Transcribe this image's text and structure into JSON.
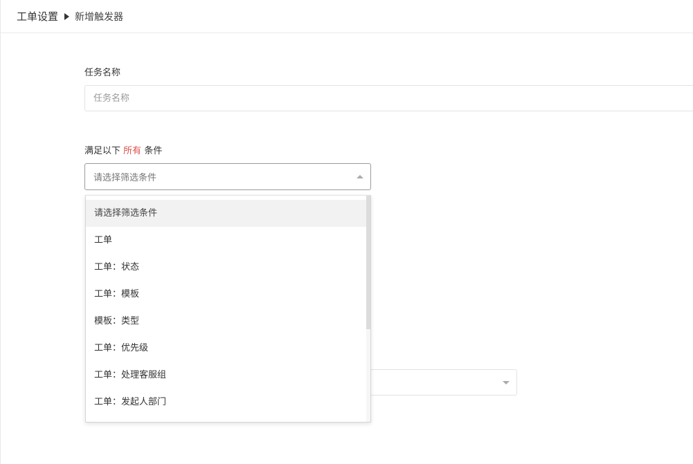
{
  "breadcrumb": {
    "root": "工单设置",
    "current": "新增触发器"
  },
  "task_name": {
    "label": "任务名称",
    "placeholder": "任务名称",
    "value": ""
  },
  "condition": {
    "label_prefix": "满足以下",
    "label_highlight": "所有",
    "label_suffix": "条件",
    "highlight_color": "#d9534f",
    "select_placeholder": "请选择筛选条件",
    "expanded": true
  },
  "dropdown": {
    "options": [
      "请选择筛选条件",
      "工单",
      "工单：状态",
      "工单：模板",
      "模板：类型",
      "工单：优先级",
      "工单：处理客服组",
      "工单：发起人部门"
    ],
    "highlighted_index": 0
  }
}
